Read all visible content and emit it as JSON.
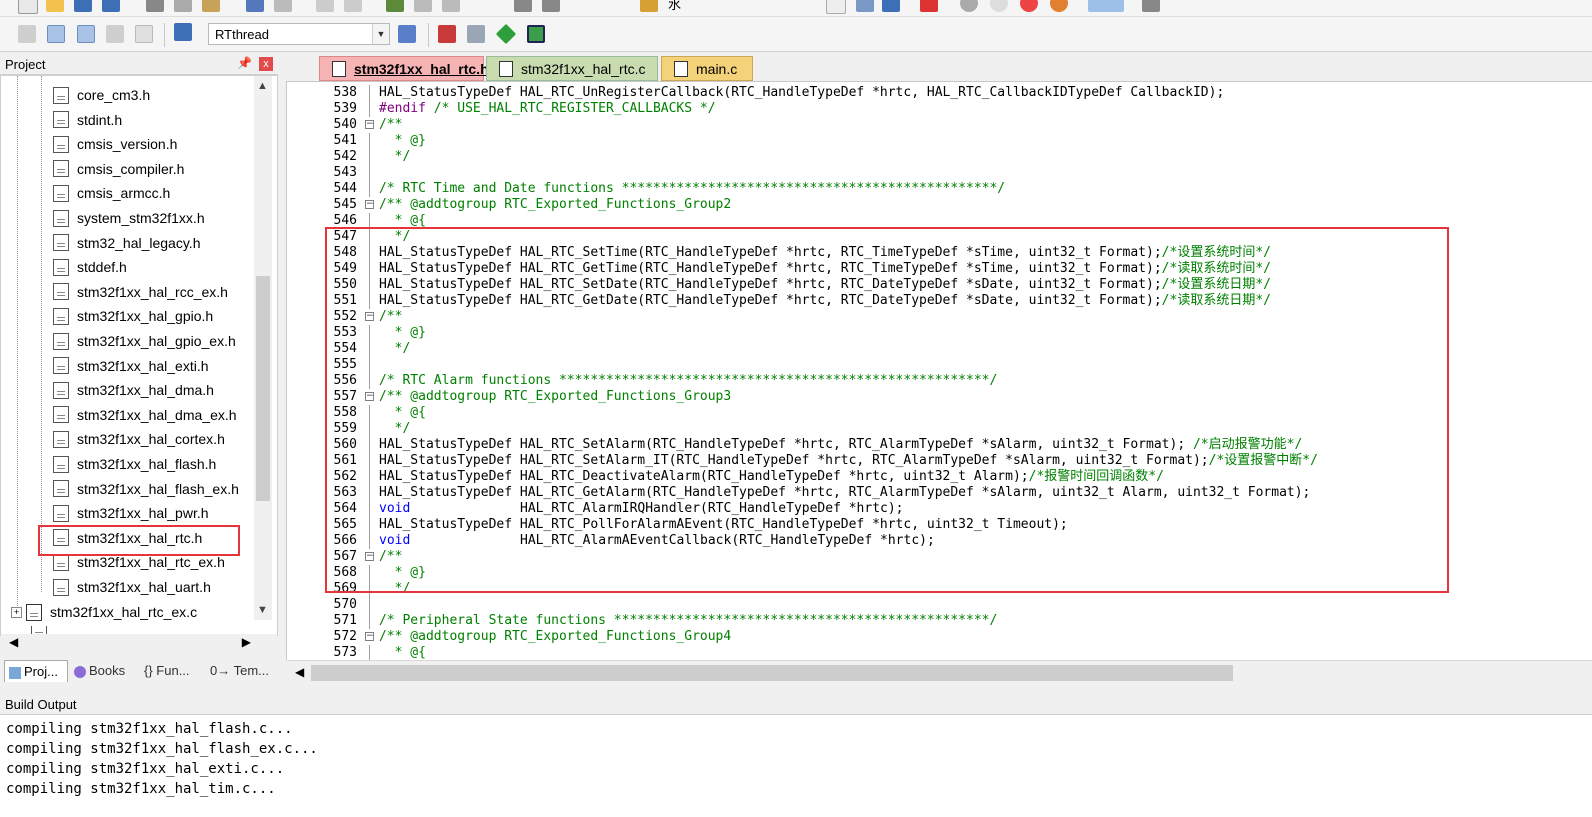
{
  "toolbar": {
    "target_name": "RTthread",
    "top_text": "水"
  },
  "project_panel": {
    "title": "Project",
    "pin": "↑",
    "close": "x",
    "files": [
      "core_cm3.h",
      "stdint.h",
      "cmsis_version.h",
      "cmsis_compiler.h",
      "cmsis_armcc.h",
      "system_stm32f1xx.h",
      "stm32_hal_legacy.h",
      "stddef.h",
      "stm32f1xx_hal_rcc_ex.h",
      "stm32f1xx_hal_gpio.h",
      "stm32f1xx_hal_gpio_ex.h",
      "stm32f1xx_hal_exti.h",
      "stm32f1xx_hal_dma.h",
      "stm32f1xx_hal_dma_ex.h",
      "stm32f1xx_hal_cortex.h",
      "stm32f1xx_hal_flash.h",
      "stm32f1xx_hal_flash_ex.h",
      "stm32f1xx_hal_pwr.h",
      "stm32f1xx_hal_rtc.h",
      "stm32f1xx_hal_rtc_ex.h",
      "stm32f1xx_hal_uart.h"
    ],
    "group_item": "stm32f1xx_hal_rtc_ex.c",
    "selected_file": "stm32f1xx_hal_rtc.h",
    "tabs": [
      "Proj...",
      "Books",
      "{} Fun...",
      "0→ Tem..."
    ]
  },
  "editor": {
    "tabs": [
      {
        "label": "stm32f1xx_hal_rtc.h",
        "active": true
      },
      {
        "label": "stm32f1xx_hal_rtc.c",
        "active": false
      },
      {
        "label": "main.c",
        "active": false
      }
    ],
    "lines": [
      {
        "n": "538",
        "text": "HAL_StatusTypeDef HAL_RTC_UnRegisterCallback(RTC_HandleTypeDef *hrtc, HAL_RTC_CallbackIDTypeDef CallbackID);",
        "comment": ""
      },
      {
        "n": "539",
        "text": "",
        "comment": "",
        "pp": "#endif",
        "pp_comment": " /* USE_HAL_RTC_REGISTER_CALLBACKS */"
      },
      {
        "n": "540",
        "text": "",
        "comment": "/**",
        "fold": "-"
      },
      {
        "n": "541",
        "text": "",
        "comment": "  * @}"
      },
      {
        "n": "542",
        "text": "",
        "comment": "  */"
      },
      {
        "n": "543",
        "text": "",
        "comment": ""
      },
      {
        "n": "544",
        "text": "",
        "comment": "/* RTC Time and Date functions ************************************************/"
      },
      {
        "n": "545",
        "text": "",
        "comment": "/** @addtogroup RTC_Exported_Functions_Group2",
        "fold": "-"
      },
      {
        "n": "546",
        "text": "",
        "comment": "  * @{"
      },
      {
        "n": "547",
        "text": "",
        "comment": "  */"
      },
      {
        "n": "548",
        "text": "HAL_StatusTypeDef HAL_RTC_SetTime(RTC_HandleTypeDef *hrtc, RTC_TimeTypeDef *sTime, uint32_t Format);",
        "comment": "/*设置系统时间*/"
      },
      {
        "n": "549",
        "text": "HAL_StatusTypeDef HAL_RTC_GetTime(RTC_HandleTypeDef *hrtc, RTC_TimeTypeDef *sTime, uint32_t Format);",
        "comment": "/*读取系统时间*/"
      },
      {
        "n": "550",
        "text": "HAL_StatusTypeDef HAL_RTC_SetDate(RTC_HandleTypeDef *hrtc, RTC_DateTypeDef *sDate, uint32_t Format);",
        "comment": "/*设置系统日期*/"
      },
      {
        "n": "551",
        "text": "HAL_StatusTypeDef HAL_RTC_GetDate(RTC_HandleTypeDef *hrtc, RTC_DateTypeDef *sDate, uint32_t Format);",
        "comment": "/*读取系统日期*/"
      },
      {
        "n": "552",
        "text": "",
        "comment": "/**",
        "fold": "-"
      },
      {
        "n": "553",
        "text": "",
        "comment": "  * @}"
      },
      {
        "n": "554",
        "text": "",
        "comment": "  */"
      },
      {
        "n": "555",
        "text": "",
        "comment": ""
      },
      {
        "n": "556",
        "text": "",
        "comment": "/* RTC Alarm functions *******************************************************/"
      },
      {
        "n": "557",
        "text": "",
        "comment": "/** @addtogroup RTC_Exported_Functions_Group3",
        "fold": "-"
      },
      {
        "n": "558",
        "text": "",
        "comment": "  * @{"
      },
      {
        "n": "559",
        "text": "",
        "comment": "  */"
      },
      {
        "n": "560",
        "text": "HAL_StatusTypeDef HAL_RTC_SetAlarm(RTC_HandleTypeDef *hrtc, RTC_AlarmTypeDef *sAlarm, uint32_t Format); ",
        "comment": "/*启动报警功能*/"
      },
      {
        "n": "561",
        "text": "HAL_StatusTypeDef HAL_RTC_SetAlarm_IT(RTC_HandleTypeDef *hrtc, RTC_AlarmTypeDef *sAlarm, uint32_t Format);",
        "comment": "/*设置报警中断*/"
      },
      {
        "n": "562",
        "text": "HAL_StatusTypeDef HAL_RTC_DeactivateAlarm(RTC_HandleTypeDef *hrtc, uint32_t Alarm);",
        "comment": "/*报警时间回调函数*/"
      },
      {
        "n": "563",
        "text": "HAL_StatusTypeDef HAL_RTC_GetAlarm(RTC_HandleTypeDef *hrtc, RTC_AlarmTypeDef *sAlarm, uint32_t Alarm, uint32_t Format);",
        "comment": ""
      },
      {
        "n": "564",
        "text": "                  HAL_RTC_AlarmIRQHandler(RTC_HandleTypeDef *hrtc);",
        "comment": "",
        "kw": "void"
      },
      {
        "n": "565",
        "text": "HAL_StatusTypeDef HAL_RTC_PollForAlarmAEvent(RTC_HandleTypeDef *hrtc, uint32_t Timeout);",
        "comment": ""
      },
      {
        "n": "566",
        "text": "                  HAL_RTC_AlarmAEventCallback(RTC_HandleTypeDef *hrtc);",
        "comment": "",
        "kw": "void"
      },
      {
        "n": "567",
        "text": "",
        "comment": "/**",
        "fold": "-"
      },
      {
        "n": "568",
        "text": "",
        "comment": "  * @}"
      },
      {
        "n": "569",
        "text": "",
        "comment": "  */"
      },
      {
        "n": "570",
        "text": "",
        "comment": ""
      },
      {
        "n": "571",
        "text": "",
        "comment": "/* Peripheral State functions ************************************************/"
      },
      {
        "n": "572",
        "text": "",
        "comment": "/** @addtogroup RTC_Exported_Functions_Group4",
        "fold": "-"
      },
      {
        "n": "573",
        "text": "",
        "comment": "  * @{"
      }
    ]
  },
  "build_output": {
    "title": "Build Output",
    "lines": [
      "compiling stm32f1xx_hal_flash.c...",
      "compiling stm32f1xx_hal_flash_ex.c...",
      "compiling stm32f1xx_hal_exti.c...",
      "compiling stm32f1xx_hal_tim.c..."
    ]
  },
  "colors": {
    "comment": "#008000",
    "keyword": "#0000ff",
    "highlight_box": "#e5343a",
    "active_tab": "#f5b3b3",
    "inactive_tab": "#c9dcb0",
    "main_tab": "#f4d27a"
  }
}
